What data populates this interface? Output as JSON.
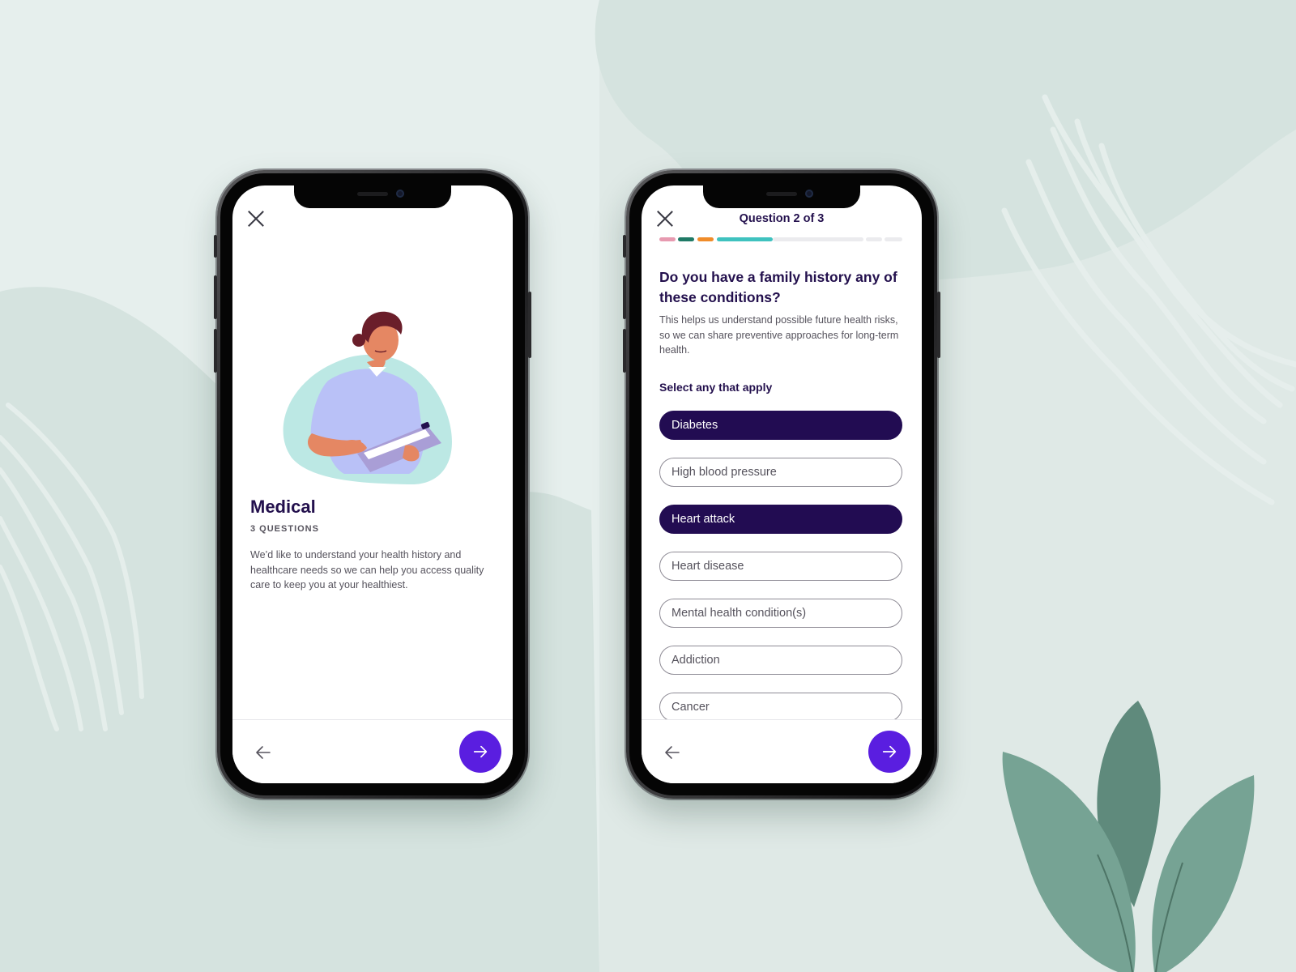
{
  "colors": {
    "background": "#dfe9e6",
    "primary_dark": "#23104d",
    "accent_button": "#5a1ee0",
    "selected_option": "#220c52",
    "progress_segments": [
      "#e79ab0",
      "#1f7a66",
      "#f08c2a",
      "#3fc2bf"
    ],
    "progress_track": "#ebebee"
  },
  "intro_screen": {
    "title": "Medical",
    "subtitle": "3 QUESTIONS",
    "description": "We’d like to understand your health history and healthcare needs so we can help you access quality care to keep you at your healthiest.",
    "icons": {
      "close": "close-icon",
      "back": "arrow-left-icon",
      "next": "arrow-right-icon",
      "illustration": "nurse-with-clipboard-illustration"
    }
  },
  "question_screen": {
    "counter": "Question 2 of 3",
    "progress_fraction": 0.47,
    "title": "Do you have a family history any of these conditions?",
    "help_text": "This helps us understand possible future health risks, so we can share preventive approaches for long-term health.",
    "select_label": "Select any that apply",
    "options": [
      {
        "label": "Diabetes",
        "selected": true
      },
      {
        "label": "High blood pressure",
        "selected": false
      },
      {
        "label": "Heart attack",
        "selected": true
      },
      {
        "label": "Heart disease",
        "selected": false
      },
      {
        "label": "Mental health condition(s)",
        "selected": false
      },
      {
        "label": "Addiction",
        "selected": false
      },
      {
        "label": "Cancer",
        "selected": false
      }
    ],
    "icons": {
      "close": "close-icon",
      "back": "arrow-left-icon",
      "next": "arrow-right-icon"
    }
  }
}
